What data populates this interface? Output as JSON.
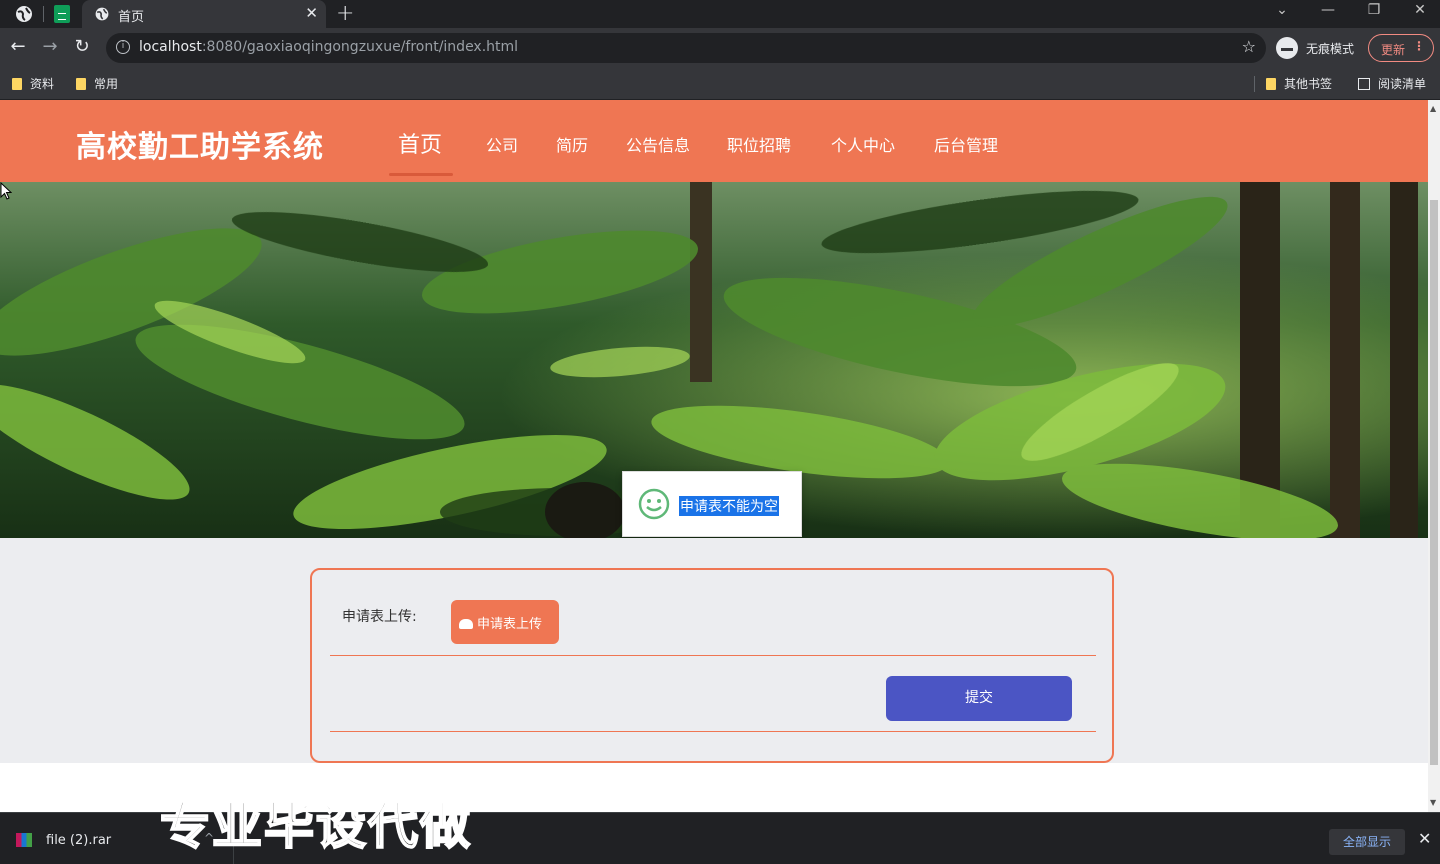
{
  "browser": {
    "tab_title": "首页",
    "tab_close": "✕",
    "new_tab": "+",
    "url_host": "localhost",
    "url_path": ":8080/gaoxiaoqingongzuxue/front/index.html",
    "incognito_label": "无痕模式",
    "update_label": "更新",
    "bookmarks": [
      "资料",
      "常用"
    ],
    "other_bookmarks": "其他书签",
    "reading_list": "阅读清单"
  },
  "site": {
    "title": "高校勤工助学系统",
    "nav": [
      "首页",
      "公司",
      "简历",
      "公告信息",
      "职位招聘",
      "个人中心",
      "后台管理"
    ],
    "active_nav_index": 0,
    "brand_color": "#ef7653"
  },
  "banner": {
    "slide_count": 3,
    "active_slide": 1
  },
  "toast": {
    "message": "申请表不能为空",
    "icon": "smile-icon"
  },
  "form": {
    "upload_label": "申请表上传:",
    "upload_button": "申请表上传",
    "submit_button": "提交",
    "submit_color": "#4b55c4"
  },
  "watermark": "专业毕设代做",
  "downloads": {
    "file_name": "file (2).rar",
    "show_all": "全部显示"
  }
}
